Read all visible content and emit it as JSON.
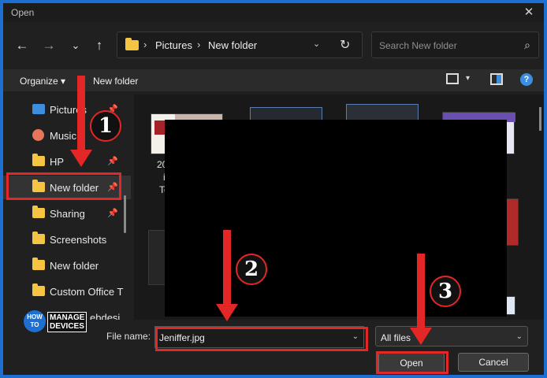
{
  "window": {
    "title": "Open",
    "close_glyph": "✕"
  },
  "nav": {
    "back_glyph": "←",
    "forward_glyph": "→",
    "recent_glyph": "⌄",
    "up_glyph": "↑"
  },
  "address": {
    "crumbs": [
      "Pictures",
      "New folder"
    ],
    "separator": "›",
    "dropdown_glyph": "⌄",
    "refresh_glyph": "↻"
  },
  "search": {
    "placeholder": "Search New folder",
    "icon_glyph": "⌕"
  },
  "commands": {
    "organize": "Organize ▾",
    "new_folder": "New folder",
    "view_dd": "▾",
    "help": "?"
  },
  "sidebar": {
    "items": [
      {
        "label": "Pictures",
        "icon": "pictures-icon",
        "pinned": true
      },
      {
        "label": "Music",
        "icon": "music-icon",
        "pinned": true
      },
      {
        "label": "HP",
        "icon": "folder-icon",
        "pinned": true
      },
      {
        "label": "New folder",
        "icon": "folder-icon",
        "pinned": true,
        "selected": true
      },
      {
        "label": "Sharing",
        "icon": "folder-icon",
        "pinned": true
      },
      {
        "label": "Screenshots",
        "icon": "folder-icon",
        "pinned": false
      },
      {
        "label": "New folder",
        "icon": "folder-icon",
        "pinned": false
      },
      {
        "label": "Custom Office T",
        "icon": "folder-icon",
        "pinned": false
      },
      {
        "label": "ebdesi",
        "icon": "folder-icon",
        "pinned": false
      }
    ],
    "pin_glyph": "📌"
  },
  "content": {
    "captions": [
      "20",
      "i",
      "Te"
    ]
  },
  "footer": {
    "filename_label": "File name:",
    "filename_value": "Jeniffer.jpg",
    "dropdown_glyph": "⌄",
    "filter_value": "All files",
    "open_label": "Open",
    "cancel_label": "Cancel"
  },
  "annotations": {
    "step1": "1",
    "step2": "2",
    "step3": "3",
    "color": "#e32626"
  },
  "logo": {
    "how_to": "HOW TO",
    "manage": "MANAGE",
    "devices": "DEVICES"
  }
}
